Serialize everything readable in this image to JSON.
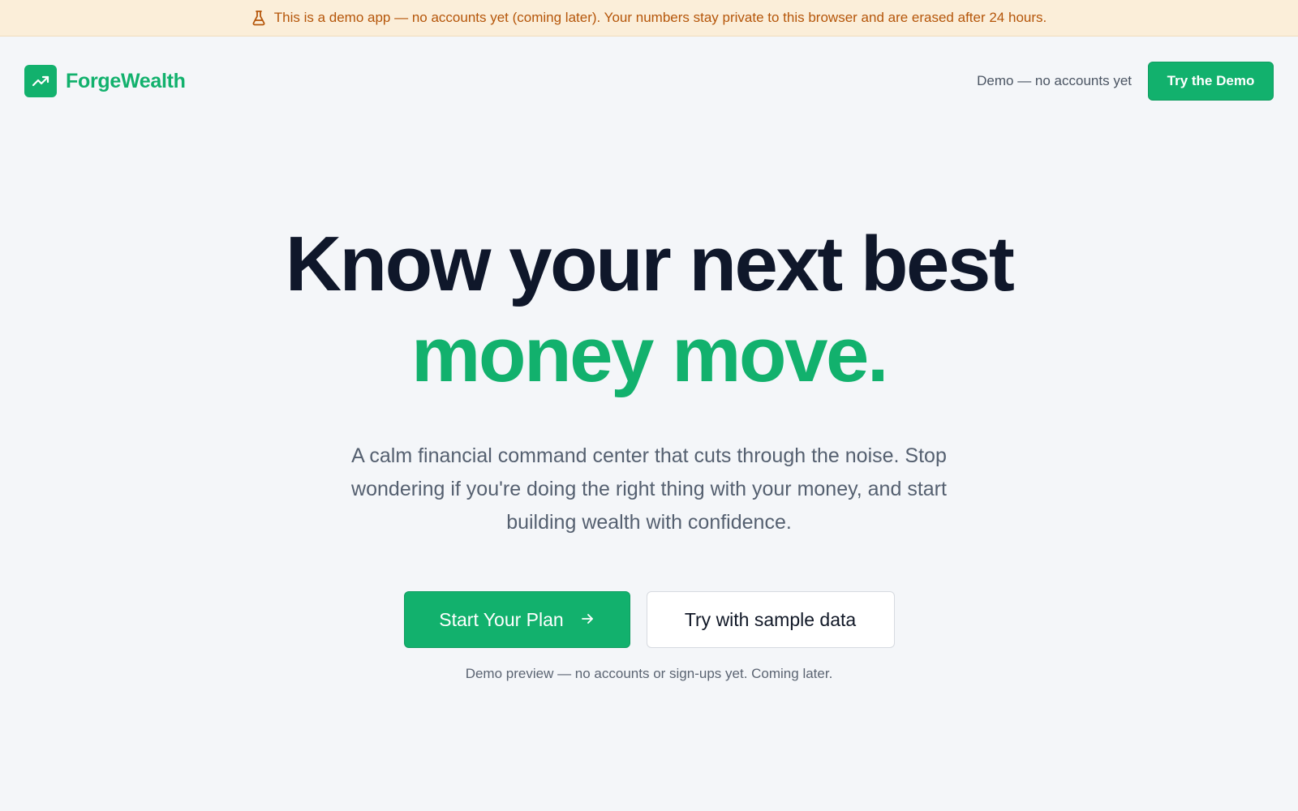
{
  "banner": {
    "icon": "flask-icon",
    "text": "This is a demo app — no accounts yet (coming later). Your numbers stay private to this browser and are erased after 24 hours.",
    "color": "#b5560a",
    "background": "#fbeed9"
  },
  "header": {
    "brand_icon": "trending-up-icon",
    "brand_name": "ForgeWealth",
    "note": "Demo — no accounts yet",
    "cta_label": "Try the Demo"
  },
  "hero": {
    "title_line1": "Know your next best",
    "title_line2": "money move.",
    "subtitle": "A calm financial command center that cuts through the noise. Stop wondering if you're doing the right thing with your money, and start building wealth with confidence.",
    "primary_cta_label": "Start Your Plan",
    "primary_cta_icon": "arrow-right-icon",
    "secondary_cta_label": "Try with sample data",
    "footnote": "Demo preview — no accounts or sign-ups yet. Coming later."
  },
  "colors": {
    "accent": "#12b16d",
    "page_background": "#f4f6f9",
    "heading": "#0f172a"
  }
}
